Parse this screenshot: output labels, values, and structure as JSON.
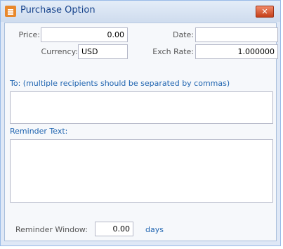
{
  "window": {
    "title": "Purchase Option",
    "icon": "app-icon",
    "close_label": "✕"
  },
  "form": {
    "price_label": "Price:",
    "price_value": "0.00",
    "date_label": "Date:",
    "date_value": "",
    "currency_label": "Currency:",
    "currency_value": "USD",
    "exch_rate_label": "Exch Rate:",
    "exch_rate_value": "1.000000"
  },
  "to": {
    "label": "To: (multiple recipients should be separated by commas)",
    "value": ""
  },
  "reminder": {
    "label": "Reminder Text:",
    "value": ""
  },
  "reminder_window": {
    "label": "Reminder Window:",
    "value": "0.00",
    "unit": "days"
  }
}
